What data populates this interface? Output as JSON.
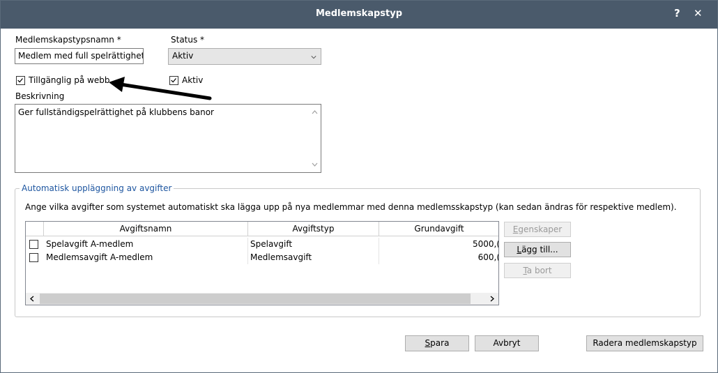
{
  "window": {
    "title": "Medlemskapstyp",
    "help_label": "?",
    "close_label": "✕"
  },
  "form": {
    "name_label": "Medlemskapstypsnamn *",
    "name_value": "Medlem med full spelrättighet",
    "status_label": "Status *",
    "status_value": "Aktiv",
    "web_checkbox_label": "Tillgänglig på webb",
    "web_checked": true,
    "active_checkbox_label": "Aktiv",
    "active_checked": true,
    "description_label": "Beskrivning",
    "description_value": "Ger fullständigspelrättighet på klubbens banor"
  },
  "fees": {
    "group_title": "Automatisk uppläggning av avgifter",
    "instruction": "Ange vilka avgifter som systemet automatiskt ska lägga upp på nya medlemmar med denna medlemsskapstyp (kan sedan ändras för respektive medlem).",
    "columns": [
      "Avgiftsnamn",
      "Avgiftstyp",
      "Grundavgift"
    ],
    "rows": [
      {
        "checked": false,
        "name": "Spelavgift A-medlem",
        "type": "Spelavgift",
        "amount": "5000,("
      },
      {
        "checked": false,
        "name": "Medlemsavgift A-medlem",
        "type": "Medlemsavgift",
        "amount": "600,("
      }
    ],
    "buttons": {
      "properties": {
        "accel": "E",
        "rest": "genskaper",
        "enabled": false
      },
      "add": {
        "accel": "L",
        "rest": "ägg till...",
        "enabled": true
      },
      "remove": {
        "accel": "T",
        "rest": "a bort",
        "enabled": false
      }
    }
  },
  "footer": {
    "save": {
      "accel": "S",
      "rest": "para"
    },
    "cancel_label": "Avbryt",
    "delete_label": "Radera medlemskapstyp"
  },
  "colors": {
    "titlebar": "#4a5a6b",
    "group_title": "#1e56a0",
    "annotation_arrow": "#000000"
  },
  "icons": {
    "close": "close-icon",
    "help": "help-icon",
    "dropdown": "chevron-down-icon",
    "scroll_left": "scroll-left-icon",
    "scroll_right": "scroll-right-icon",
    "scroll_up": "scroll-up-icon",
    "scroll_down": "scroll-down-icon",
    "annotation": "annotation-arrow-icon"
  }
}
